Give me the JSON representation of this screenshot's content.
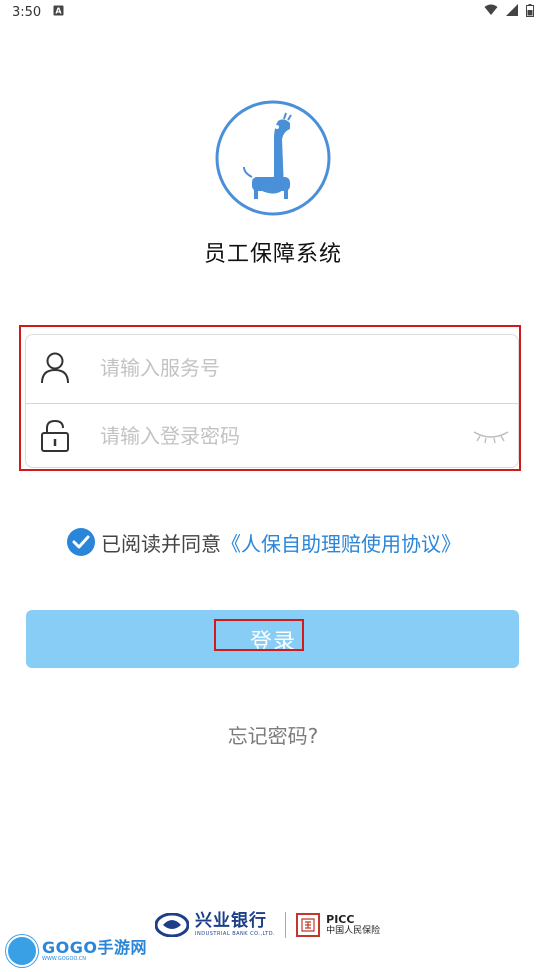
{
  "status_bar": {
    "time": "3:50",
    "notification_icon": "a-box-icon",
    "right_icons": [
      "wifi-icon",
      "signal-icon",
      "battery-icon"
    ]
  },
  "app": {
    "logo_icon": "giraffe-logo-icon",
    "title": "员工保障系统"
  },
  "form": {
    "username": {
      "icon": "user-icon",
      "placeholder": "请输入服务号",
      "value": ""
    },
    "password": {
      "icon": "lock-icon",
      "placeholder": "请输入登录密码",
      "value": "",
      "toggle_icon": "eye-closed-icon"
    }
  },
  "agreement": {
    "checked": true,
    "text": "已阅读并同意",
    "link": "《人保自助理赔使用协议》"
  },
  "login_button": {
    "label": "登录"
  },
  "forgot_password": {
    "label": "忘记密码?"
  },
  "footer": {
    "bank_name_cn": "兴业银行",
    "bank_name_en": "INDUSTRIAL BANK CO.,LTD.",
    "insurer_name_en": "PICC",
    "insurer_name_cn": "中国人民保险"
  },
  "watermark": {
    "text": "GOGO手游网",
    "sub": "WWW.GOGOO.CN"
  },
  "colors": {
    "accent": "#2a86d8",
    "button_bg": "#88cdf6",
    "highlight_border": "#d11a1a",
    "logo_ring": "#4a90d9"
  }
}
